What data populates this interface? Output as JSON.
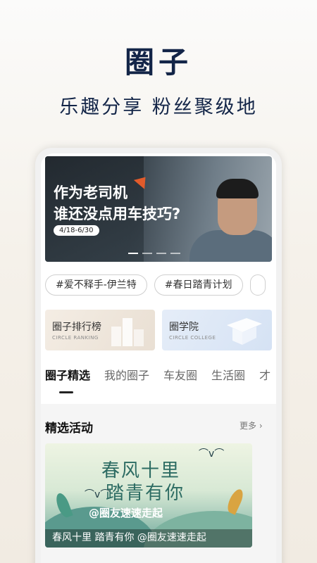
{
  "header": {
    "title": "圈子",
    "subtitle": "乐趣分享 粉丝聚级地"
  },
  "banner": {
    "line1": "作为老司机",
    "line2": "谁还没点用车技巧?",
    "date": "4/18-6/30",
    "slide_count": 4,
    "active_slide": 1
  },
  "tags": [
    "#爱不释手-伊兰特",
    "#春日踏青计划"
  ],
  "cards": [
    {
      "title": "圈子排行榜",
      "subtitle": "CIRCLE RANKING"
    },
    {
      "title": "圈学院",
      "subtitle": "CIRCLE COLLEGE"
    }
  ],
  "tabs": [
    "圈子精选",
    "我的圈子",
    "车友圈",
    "生活圈",
    "才"
  ],
  "section": {
    "title": "精选活动",
    "more": "更多 ›",
    "event": {
      "art_line1": "春风十里",
      "art_line2": "踏青有你",
      "art_line3": "@圈友速速走起",
      "caption": "春风十里 踏青有你 @圈友速速走起"
    }
  },
  "colors": {
    "title_navy": "#132548",
    "accent_orange": "#e25b2b"
  }
}
